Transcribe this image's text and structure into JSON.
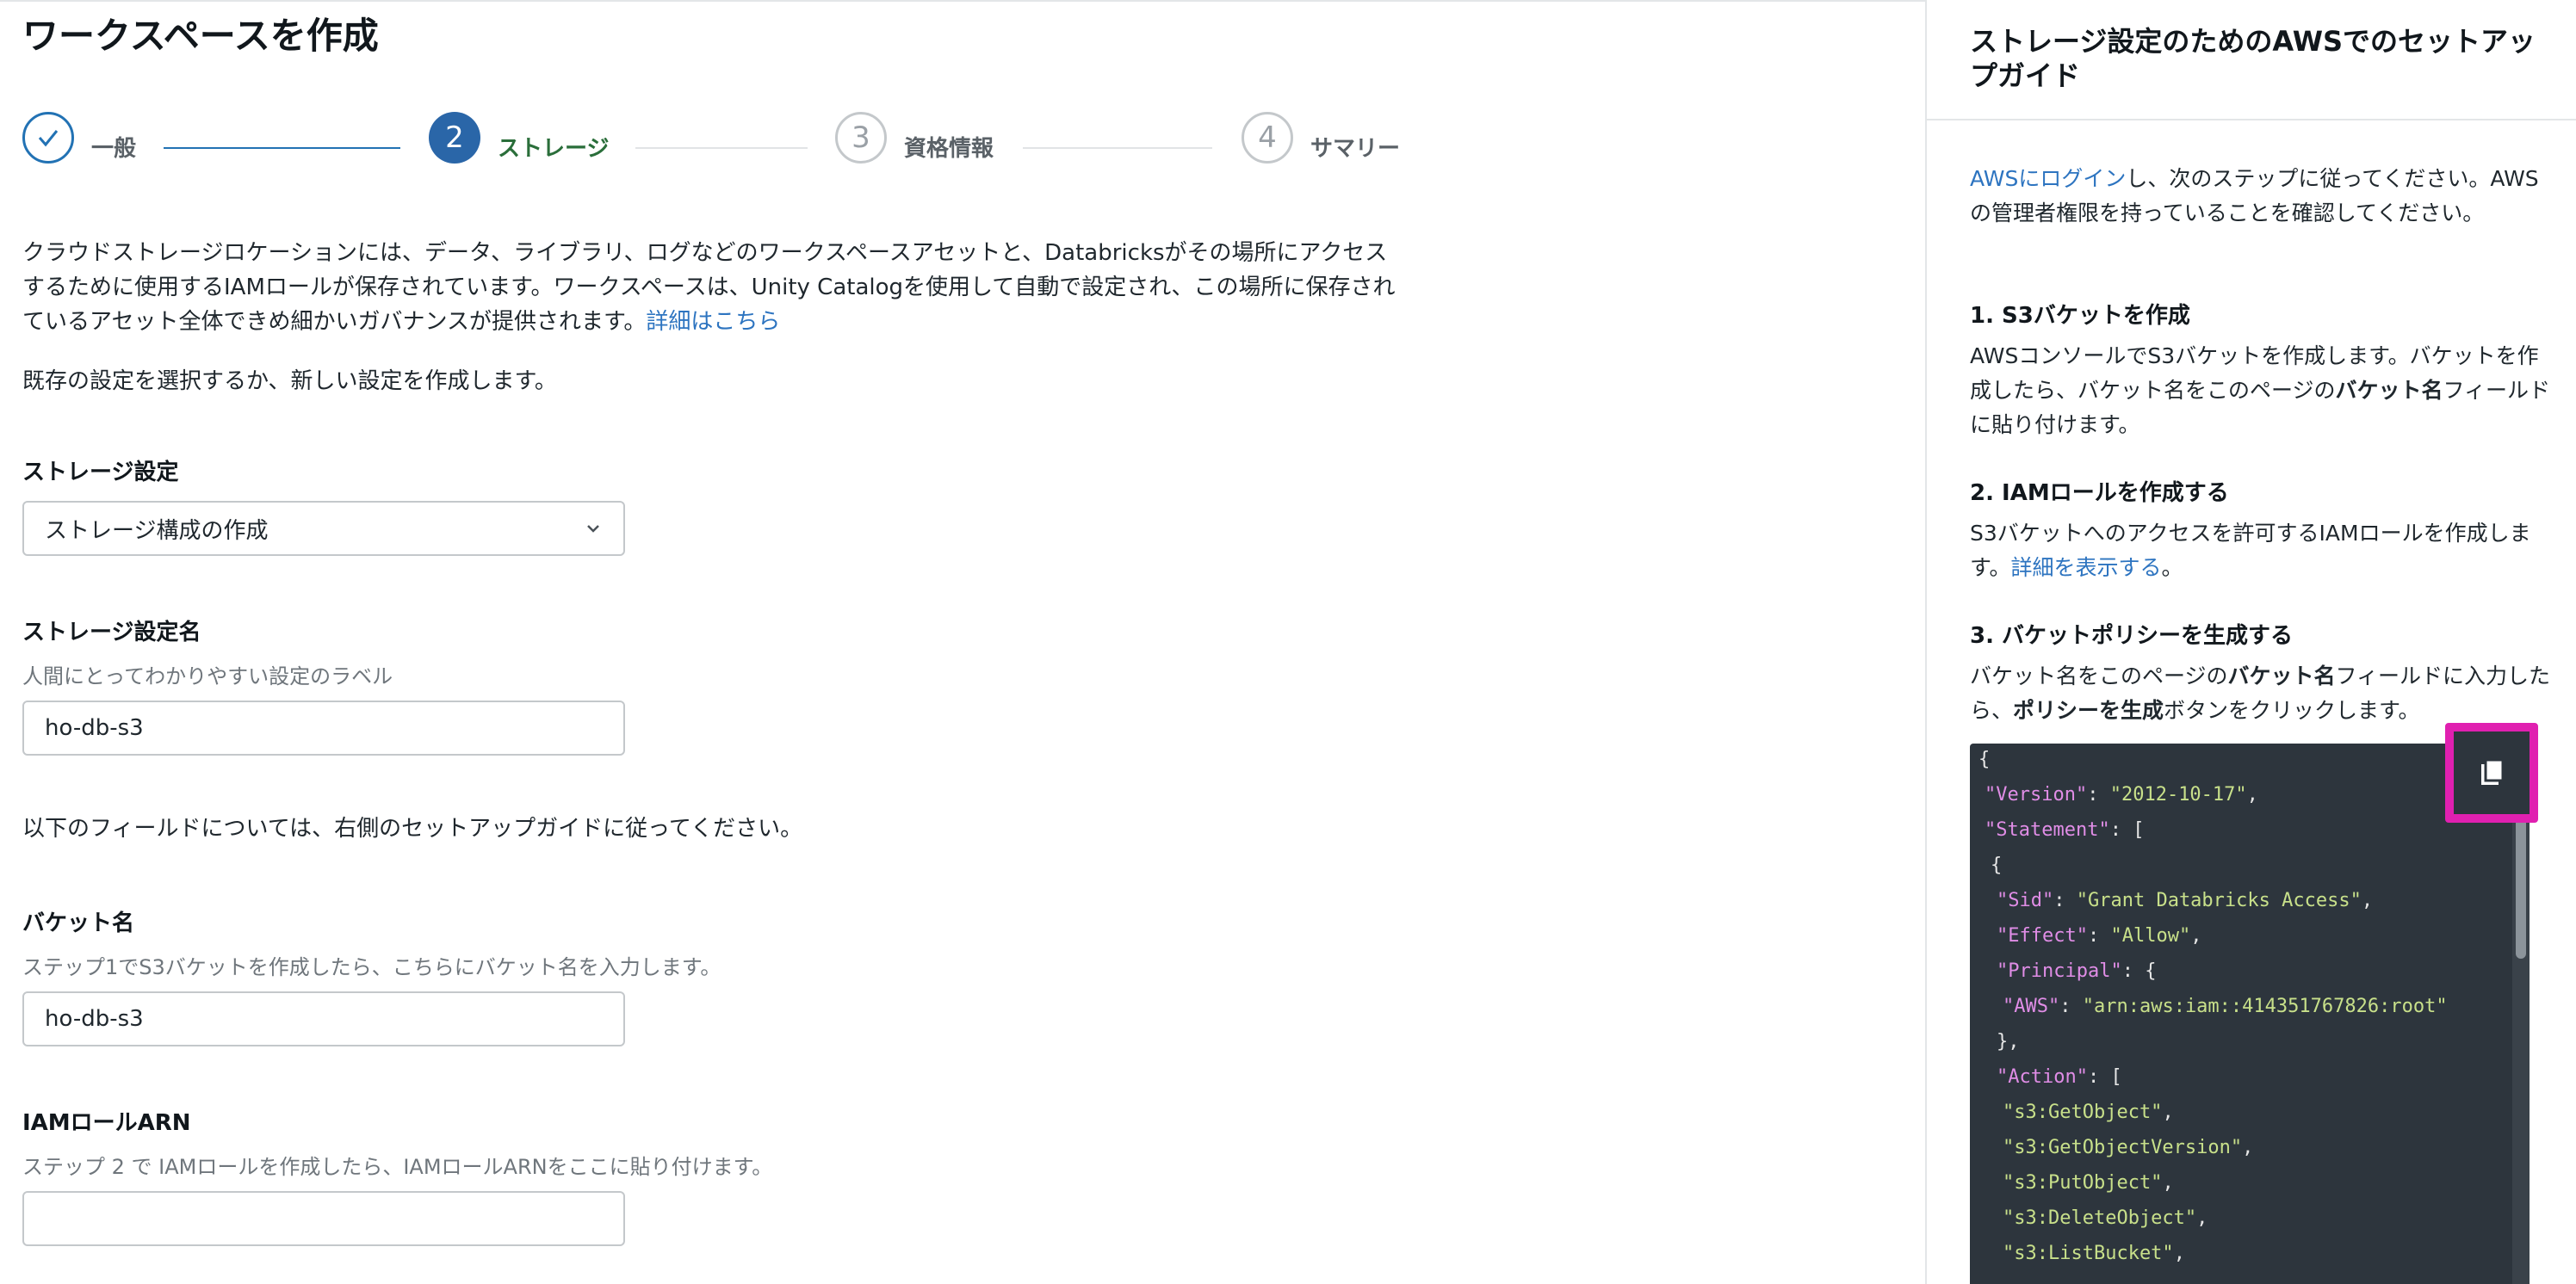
{
  "page": {
    "title": "ワークスペースを作成"
  },
  "stepper": {
    "steps": [
      {
        "number": "",
        "label": "一般",
        "state": "done"
      },
      {
        "number": "2",
        "label": "ストレージ",
        "state": "current"
      },
      {
        "number": "3",
        "label": "資格情報",
        "state": "pending"
      },
      {
        "number": "4",
        "label": "サマリー",
        "state": "pending"
      }
    ]
  },
  "intro": {
    "text": "クラウドストレージロケーションには、データ、ライブラリ、ログなどのワークスペースアセットと、Databricksがその場所にアクセスするために使用するIAMロールが保存されています。ワークスペースは、Unity Catalogを使用して自動で設定され、この場所に保存されているアセット全体できめ細かいガバナンスが提供されます。",
    "link": "詳細はこちら",
    "sub": "既存の設定を選択するか、新しい設定を作成します。"
  },
  "form": {
    "storage_config": {
      "label": "ストレージ設定",
      "value": "ストレージ構成の作成"
    },
    "storage_name": {
      "label": "ストレージ設定名",
      "help": "人間にとってわかりやすい設定のラベル",
      "value": "ho-db-s3"
    },
    "note": "以下のフィールドについては、右側のセットアップガイドに従ってください。",
    "bucket_name": {
      "label": "バケット名",
      "help": "ステップ1でS3バケットを作成したら、こちらにバケット名を入力します。",
      "value": "ho-db-s3"
    },
    "iam_role": {
      "label": "IAMロールARN",
      "help": "ステップ 2 で IAMロールを作成したら、IAMロールARNをここに貼り付けます。",
      "value": ""
    }
  },
  "guide": {
    "title": "ストレージ設定のためのAWSでのセットアップガイド",
    "login_link": "AWSにログイン",
    "login_text": "し、次のステップに従ってください。AWSの管理者権限を持っていることを確認してください。",
    "step1_title": "1. S3バケットを作成",
    "step1_a": "AWSコンソールでS3バケットを作成します。バケットを作成したら、バケット名をこのページの",
    "step1_bold": "バケット名",
    "step1_b": "フィールドに貼り付けます。",
    "step2_title": "2. IAMロールを作成する",
    "step2_text": "S3バケットへのアクセスを許可するIAMロールを作成します。",
    "step2_link": "詳細を表示する",
    "step2_end": "。",
    "step3_title": "3. バケットポリシーを生成する",
    "step3_a": "バケット名をこのページの",
    "step3_bold1": "バケット名",
    "step3_b": "フィールドに入力したら、",
    "step3_bold2": "ポリシーを生成",
    "step3_c": "ボタンをクリックします。"
  },
  "code": {
    "lines": [
      {
        "indent": 0,
        "parts": [
          [
            "p",
            "{"
          ]
        ]
      },
      {
        "indent": 1,
        "parts": [
          [
            "k",
            "\"Version\""
          ],
          [
            "p",
            ": "
          ],
          [
            "s",
            "\"2012-10-17\""
          ],
          [
            "p",
            ","
          ]
        ]
      },
      {
        "indent": 1,
        "parts": [
          [
            "k",
            "\"Statement\""
          ],
          [
            "p",
            ": ["
          ]
        ]
      },
      {
        "indent": 2,
        "parts": [
          [
            "p",
            "{"
          ]
        ]
      },
      {
        "indent": 3,
        "parts": [
          [
            "k",
            "\"Sid\""
          ],
          [
            "p",
            ": "
          ],
          [
            "s",
            "\"Grant Databricks Access\""
          ],
          [
            "p",
            ","
          ]
        ]
      },
      {
        "indent": 3,
        "parts": [
          [
            "k",
            "\"Effect\""
          ],
          [
            "p",
            ": "
          ],
          [
            "s",
            "\"Allow\""
          ],
          [
            "p",
            ","
          ]
        ]
      },
      {
        "indent": 3,
        "parts": [
          [
            "k",
            "\"Principal\""
          ],
          [
            "p",
            ": {"
          ]
        ]
      },
      {
        "indent": 4,
        "parts": [
          [
            "k",
            "\"AWS\""
          ],
          [
            "p",
            ": "
          ],
          [
            "s",
            "\"arn:aws:iam::414351767826:root\""
          ]
        ]
      },
      {
        "indent": 3,
        "parts": [
          [
            "p",
            "},"
          ]
        ]
      },
      {
        "indent": 3,
        "parts": [
          [
            "k",
            "\"Action\""
          ],
          [
            "p",
            ": ["
          ]
        ]
      },
      {
        "indent": 4,
        "parts": [
          [
            "s",
            "\"s3:GetObject\""
          ],
          [
            "p",
            ","
          ]
        ]
      },
      {
        "indent": 4,
        "parts": [
          [
            "s",
            "\"s3:GetObjectVersion\""
          ],
          [
            "p",
            ","
          ]
        ]
      },
      {
        "indent": 4,
        "parts": [
          [
            "s",
            "\"s3:PutObject\""
          ],
          [
            "p",
            ","
          ]
        ]
      },
      {
        "indent": 4,
        "parts": [
          [
            "s",
            "\"s3:DeleteObject\""
          ],
          [
            "p",
            ","
          ]
        ]
      },
      {
        "indent": 4,
        "parts": [
          [
            "s",
            "\"s3:ListBucket\""
          ],
          [
            "p",
            ","
          ]
        ]
      }
    ]
  },
  "icons": {
    "check": "check-icon",
    "chevron": "chevron-down-icon",
    "copy": "copy-icon"
  },
  "colors": {
    "accent": "#2272b4",
    "current_step_label": "#2a6e3a",
    "highlight": "#e020b0",
    "code_bg": "#2d353d"
  }
}
